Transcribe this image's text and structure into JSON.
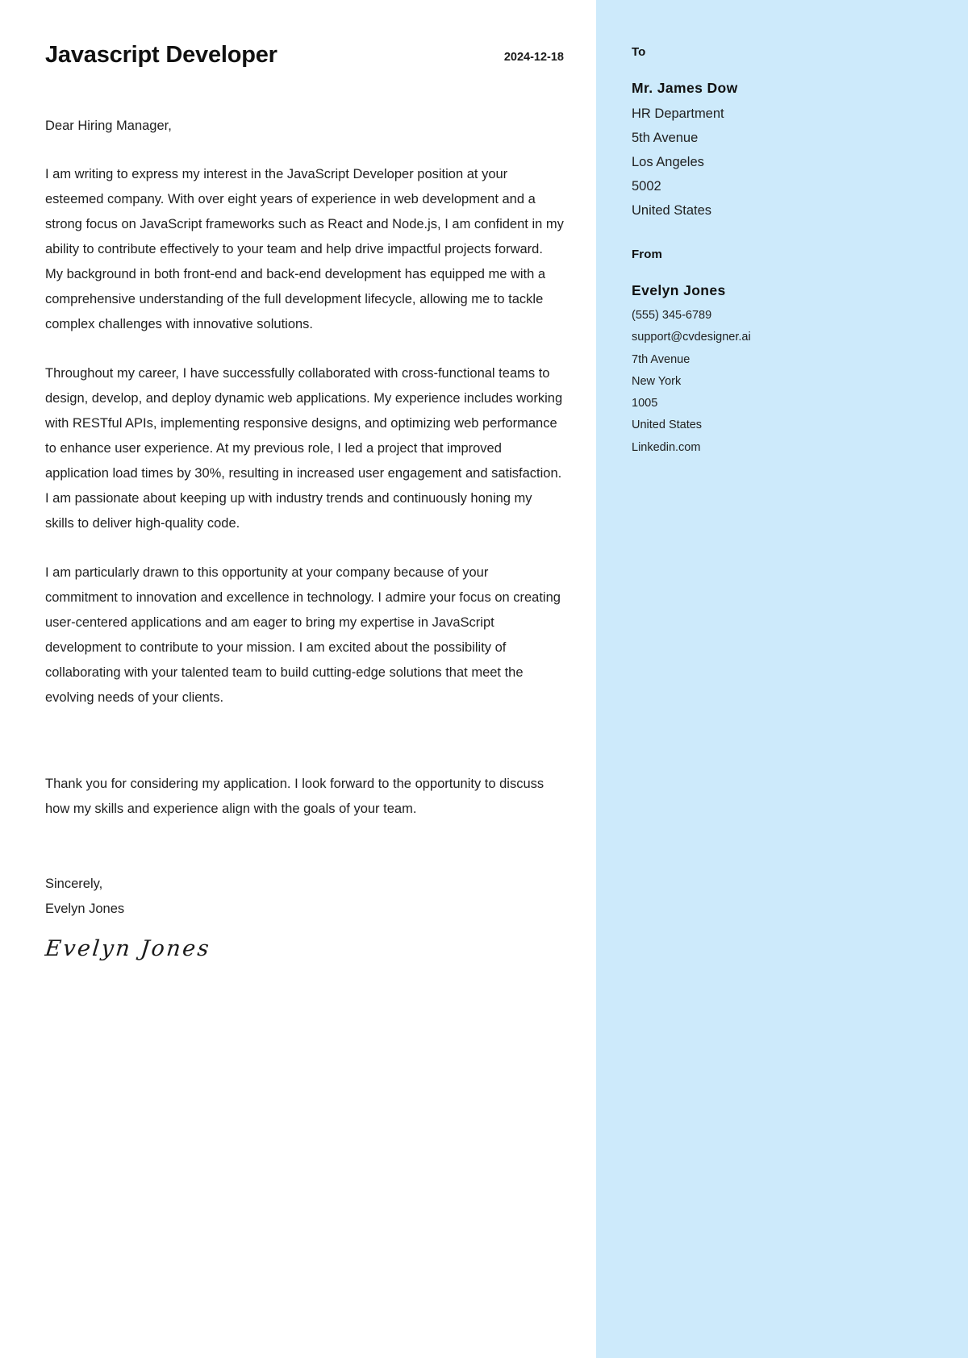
{
  "document": {
    "type": "cover-letter",
    "accent_color": "#cdeafb",
    "text_color": "#1f1f1f"
  },
  "header": {
    "job_title": "Javascript Developer",
    "date": "2024-12-18"
  },
  "letter": {
    "salutation": "Dear Hiring Manager,",
    "paragraphs": [
      "I am writing to express my interest in the JavaScript Developer position at your esteemed company. With over eight years of experience in web development and a strong focus on JavaScript frameworks such as React and Node.js, I am confident in my ability to contribute effectively to your team and help drive impactful projects forward. My background in both front-end and back-end development has equipped me with a comprehensive understanding of the full development lifecycle, allowing me to tackle complex challenges with innovative solutions.",
      "Throughout my career, I have successfully collaborated with cross-functional teams to design, develop, and deploy dynamic web applications. My experience includes working with RESTful APIs, implementing responsive designs, and optimizing web performance to enhance user experience. At my previous role, I led a project that improved application load times by 30%, resulting in increased user engagement and satisfaction. I am passionate about keeping up with industry trends and continuously honing my skills to deliver high-quality code.",
      "I am particularly drawn to this opportunity at your company because of your commitment to innovation and excellence in technology. I admire your focus on creating user-centered applications and am eager to bring my expertise in JavaScript development to contribute to your mission. I am excited about the possibility of collaborating with your talented team to build cutting-edge solutions that meet the evolving needs of your clients."
    ],
    "closing_paragraph": "Thank you for considering my application. I look forward to the opportunity to discuss how my skills and experience align with the goals of your team.",
    "signoff": "Sincerely,",
    "signoff_name": "Evelyn Jones",
    "signature": "Evelyn Jones"
  },
  "sidebar": {
    "to": {
      "heading": "To",
      "name": "Mr. James Dow",
      "lines": [
        "HR Department",
        "5th Avenue",
        "Los Angeles",
        "5002",
        "United States"
      ]
    },
    "from": {
      "heading": "From",
      "name": "Evelyn Jones",
      "lines": [
        "(555) 345-6789",
        "support@cvdesigner.ai",
        "7th Avenue",
        "New York",
        "1005",
        "United States",
        "Linkedin.com"
      ]
    }
  }
}
